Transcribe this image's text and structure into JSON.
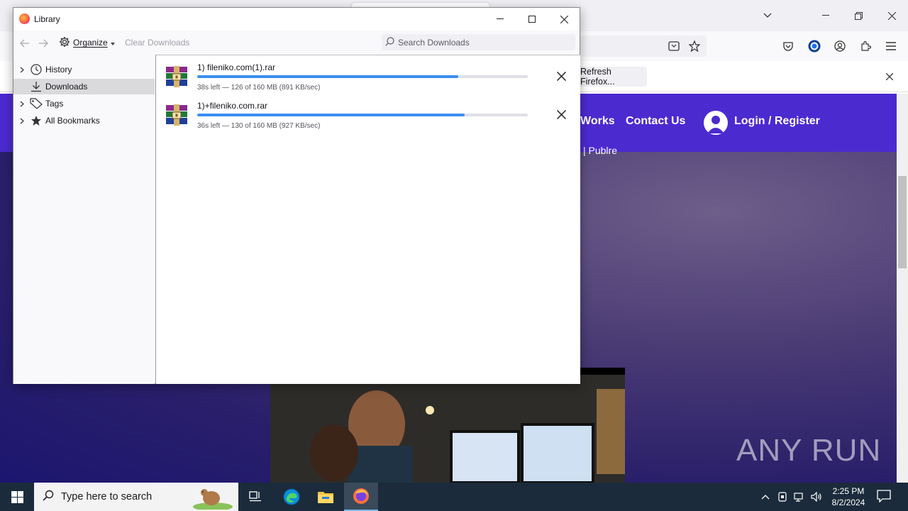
{
  "library": {
    "title": "Library",
    "toolbar": {
      "organize_label": "Organize",
      "clear_downloads_label": "Clear Downloads",
      "search_placeholder": "Search Downloads"
    },
    "sidebar": {
      "items": [
        {
          "label": "History",
          "icon": "clock-icon",
          "expandable": true,
          "selected": false
        },
        {
          "label": "Downloads",
          "icon": "download-icon",
          "expandable": false,
          "selected": true
        },
        {
          "label": "Tags",
          "icon": "tag-icon",
          "expandable": true,
          "selected": false
        },
        {
          "label": "All Bookmarks",
          "icon": "star-icon",
          "expandable": true,
          "selected": false
        }
      ]
    },
    "downloads": [
      {
        "filename": "1) fileniko.com(1).rar",
        "status": "38s left — 126 of 160 MB (891 KB/sec)",
        "progress": 0.79,
        "icon": "winrar-archive-icon"
      },
      {
        "filename": "1)+fileniko.com.rar",
        "status": "36s left — 130 of 160 MB (927 KB/sec)",
        "progress": 0.81,
        "icon": "winrar-archive-icon"
      }
    ]
  },
  "browser": {
    "notification_button": "Refresh Firefox..."
  },
  "webpage": {
    "nav_links": [
      "Works",
      "Contact Us"
    ],
    "login_label": "Login / Register",
    "subtext": "| Publre",
    "watermark": "ANY RUN"
  },
  "taskbar": {
    "search_placeholder": "Type here to search",
    "time": "2:25 PM",
    "date": "8/2/2024"
  },
  "colors": {
    "accent_progress": "#3b8ef0",
    "web_nav": "#4b2ad0",
    "taskbar": "#1b2b3b"
  }
}
